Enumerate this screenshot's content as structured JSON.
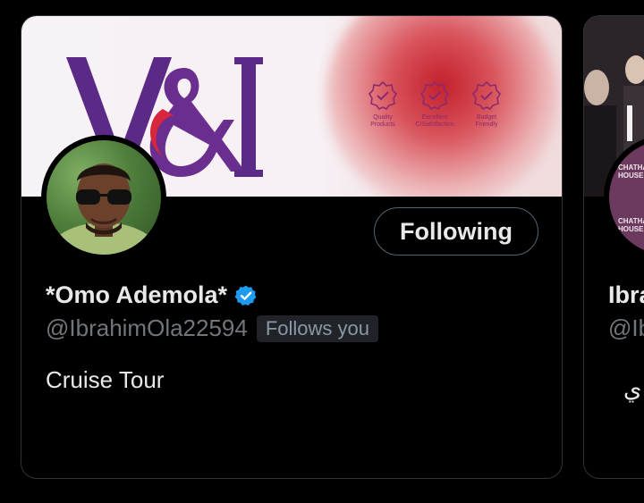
{
  "cards": [
    {
      "banner": {
        "logo_text": "V&I",
        "badges": [
          {
            "label": "Quality\nProducts",
            "icon": "check-badge-icon"
          },
          {
            "label": "Excellent\nC/Satisfaction",
            "icon": "check-badge-icon"
          },
          {
            "label": "Budget\nFriendly",
            "icon": "check-badge-icon"
          }
        ]
      },
      "follow_button_label": "Following",
      "display_name": "*Omo Ademola*",
      "verified": true,
      "handle": "@IbrahimOla22594",
      "follows_you_label": "Follows you",
      "bio": "Cruise Tour"
    },
    {
      "avatar_text": "CHATHAM\nHOUSE",
      "display_name_visible": "Ibra",
      "handle_visible": "@Ib",
      "bio_visible": "ي"
    }
  ],
  "colors": {
    "background": "#000000",
    "border": "#2f3336",
    "primary_text": "#e7e9ea",
    "secondary_text": "#71767b",
    "verified_blue": "#1d9bf0",
    "brand_purple": "#5b2a86",
    "brand_red": "#d7263d"
  }
}
